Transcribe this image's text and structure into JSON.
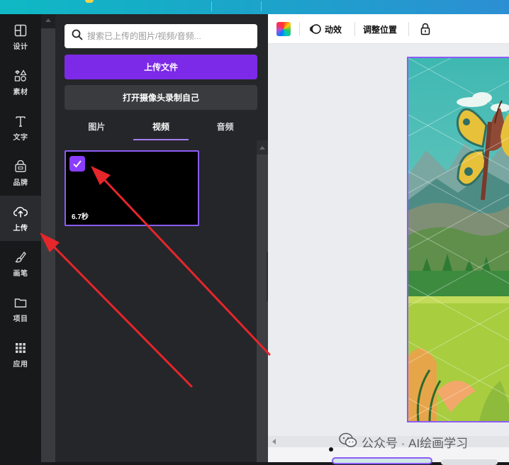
{
  "rail": {
    "items": [
      {
        "label": "设计",
        "icon": "layout-icon"
      },
      {
        "label": "素材",
        "icon": "elements-icon"
      },
      {
        "label": "文字",
        "icon": "text-icon"
      },
      {
        "label": "品牌",
        "icon": "brand-icon"
      },
      {
        "label": "上传",
        "icon": "upload-cloud-icon",
        "active": true
      },
      {
        "label": "画笔",
        "icon": "brush-icon"
      },
      {
        "label": "项目",
        "icon": "folder-icon"
      },
      {
        "label": "应用",
        "icon": "apps-grid-icon"
      }
    ]
  },
  "panel": {
    "search_placeholder": "搜索已上传的图片/视频/音频...",
    "upload_button": "上传文件",
    "camera_button": "打开摄像头录制自己",
    "tabs": [
      {
        "label": "图片"
      },
      {
        "label": "视频",
        "active": true
      },
      {
        "label": "音频"
      }
    ],
    "video": {
      "duration": "6.7秒",
      "selected": true
    }
  },
  "toolbar": {
    "animate_label": "动效",
    "position_label": "调整位置"
  },
  "watermark": {
    "text": "公众号 · AI绘画学习"
  },
  "colors": {
    "accent": "#7d2ae8",
    "selection": "#8b5cf6",
    "arrow": "#e5262b"
  }
}
